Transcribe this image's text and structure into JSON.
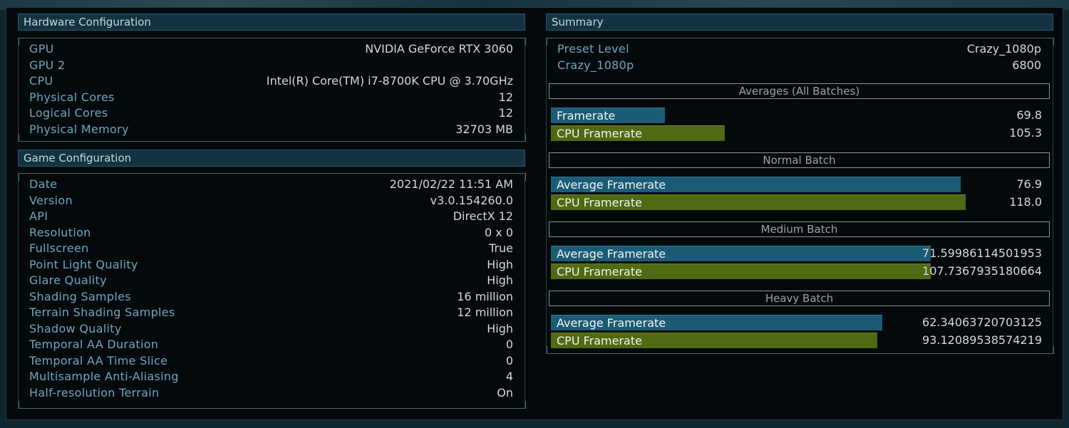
{
  "hardware": {
    "title": "Hardware Configuration",
    "rows": [
      {
        "label": "GPU",
        "value": "NVIDIA GeForce RTX 3060"
      },
      {
        "label": "GPU 2",
        "value": ""
      },
      {
        "label": "CPU",
        "value": "Intel(R) Core(TM) i7-8700K CPU @ 3.70GHz"
      },
      {
        "label": "Physical Cores",
        "value": "12"
      },
      {
        "label": "Logical Cores",
        "value": "12"
      },
      {
        "label": "Physical Memory",
        "value": "32703 MB"
      }
    ]
  },
  "game": {
    "title": "Game Configuration",
    "rows": [
      {
        "label": "Date",
        "value": "2021/02/22 11:51 AM"
      },
      {
        "label": "Version",
        "value": "v3.0.154260.0"
      },
      {
        "label": "API",
        "value": "DirectX 12"
      },
      {
        "label": "Resolution",
        "value": "0 x 0"
      },
      {
        "label": "Fullscreen",
        "value": "True"
      },
      {
        "label": "Point Light Quality",
        "value": "High"
      },
      {
        "label": "Glare Quality",
        "value": "High"
      },
      {
        "label": "Shading Samples",
        "value": "16 million"
      },
      {
        "label": "Terrain Shading Samples",
        "value": "12 million"
      },
      {
        "label": "Shadow Quality",
        "value": "High"
      },
      {
        "label": "Temporal AA Duration",
        "value": "0"
      },
      {
        "label": "Temporal AA Time Slice",
        "value": "0"
      },
      {
        "label": "Multisample Anti-Aliasing",
        "value": "4"
      },
      {
        "label": "Half-resolution Terrain",
        "value": "On"
      }
    ]
  },
  "summary": {
    "title": "Summary",
    "rows": [
      {
        "label": "Preset Level",
        "value": "Crazy_1080p"
      },
      {
        "label": "Crazy_1080p",
        "value": "6800"
      }
    ],
    "batches": [
      {
        "title": "Averages (All Batches)",
        "bars": [
          {
            "label": "Framerate",
            "value": "69.8",
            "fill": 0.228,
            "color": "blue"
          },
          {
            "label": "CPU Framerate",
            "value": "105.3",
            "fill": 0.348,
            "color": "green"
          }
        ]
      },
      {
        "title": "Normal Batch",
        "bars": [
          {
            "label": "Average Framerate",
            "value": "76.9",
            "fill": 0.822,
            "color": "blue"
          },
          {
            "label": "CPU Framerate",
            "value": "118.0",
            "fill": 0.832,
            "color": "green"
          }
        ]
      },
      {
        "title": "Medium Batch",
        "bars": [
          {
            "label": "Average Framerate",
            "value": "71.59986114501953",
            "fill": 0.762,
            "color": "blue"
          },
          {
            "label": "CPU Framerate",
            "value": "107.7367935180664",
            "fill": 0.762,
            "color": "green"
          }
        ]
      },
      {
        "title": "Heavy Batch",
        "bars": [
          {
            "label": "Average Framerate",
            "value": "62.34063720703125",
            "fill": 0.664,
            "color": "blue"
          },
          {
            "label": "CPU Framerate",
            "value": "93.12089538574219",
            "fill": 0.654,
            "color": "green"
          }
        ]
      }
    ]
  },
  "colors": {
    "label": "#6fa8bd",
    "value": "#d4d9db",
    "bar_blue": "#1b5b75",
    "bar_green": "#4f6a12",
    "header_bg": "#123442"
  }
}
